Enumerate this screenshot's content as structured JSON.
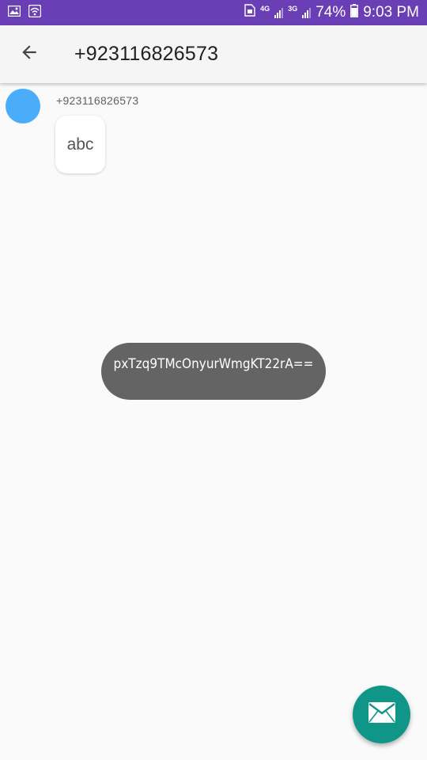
{
  "status_bar": {
    "left_icons": [
      "image-icon",
      "wifi-icon"
    ],
    "sim_icon": "sim-icon",
    "net1": "4G",
    "net2": "3G",
    "battery_percent": "74%",
    "time": "9:03 PM"
  },
  "app_bar": {
    "back_icon": "arrow-left-icon",
    "title": "+923116826573"
  },
  "message": {
    "avatar_color": "#4aadfc",
    "sender": "+923116826573",
    "text": "abc"
  },
  "toast": {
    "text": "pxTzq9TMcOnyurWmgKT22rA=="
  },
  "fab": {
    "icon": "mail-icon",
    "color": "#0f9688"
  },
  "colors": {
    "status_bar": "#6a3fb5",
    "app_bar": "#f5f5f5",
    "background": "#fafafa"
  }
}
